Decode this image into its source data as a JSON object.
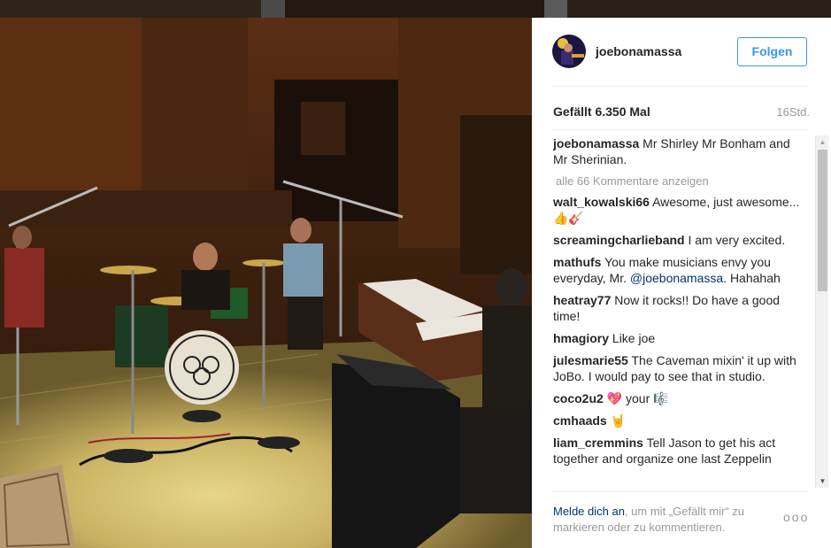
{
  "post": {
    "username": "joebonamassa",
    "follow_label": "Folgen",
    "likes": "Gefällt 6.350 Mal",
    "time": "16Std.",
    "caption_user": "joebonamassa",
    "caption_text": "Mr Shirley Mr Bonham and Mr Sherinian.",
    "view_all": "alle 66 Kommentare anzeigen"
  },
  "comments": [
    {
      "user": "walt_kowalski66",
      "text": "Awesome, just awesome...👍🎸"
    },
    {
      "user": "screamingcharlieband",
      "text": "I am very excited."
    },
    {
      "user": "mathufs",
      "text": "You make musicians envy you everyday, Mr. ",
      "mention": "@joebonamassa",
      "after": ". Hahahah"
    },
    {
      "user": "heatray77",
      "text": "Now it rocks!! Do have a good time!"
    },
    {
      "user": "hmagiory",
      "text": "Like joe"
    },
    {
      "user": "julesmarie55",
      "text": "The Caveman mixin' it up with JoBo. I would pay to see that in studio."
    },
    {
      "user": "coco2u2",
      "text": "💖 your 🎼"
    },
    {
      "user": "cmhaads",
      "text": "🤘"
    },
    {
      "user": "liam_cremmins",
      "text": "Tell Jason to get his act together and organize one last Zeppelin"
    }
  ],
  "footer": {
    "login_link": "Melde dich an",
    "login_rest": ", um mit „Gefällt mir“ zu markieren oder zu kommentieren.",
    "more_label": "ooo"
  },
  "icons": {
    "scroll_up": "scroll-up-arrow-icon",
    "scroll_down": "scroll-down-arrow-icon",
    "more": "more-options-icon"
  }
}
